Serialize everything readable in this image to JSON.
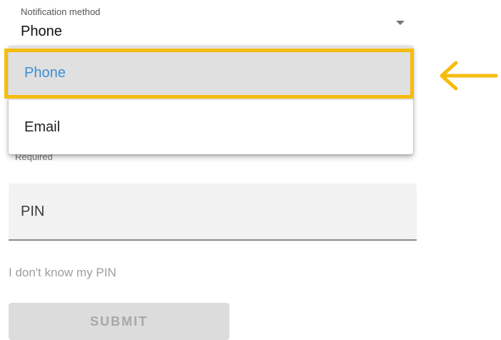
{
  "notification_select": {
    "label": "Notification method",
    "value": "Phone",
    "caret_icon": "triangle-down-icon",
    "helper_text": "Required"
  },
  "dropdown": {
    "options": [
      {
        "label": "Phone",
        "selected": true
      },
      {
        "label": "Email",
        "selected": false
      }
    ]
  },
  "annotation": {
    "highlight_color": "#f5bc0c",
    "arrow_icon": "arrow-left-icon"
  },
  "pin": {
    "placeholder": "PIN",
    "value": ""
  },
  "forgot_pin_link": "I don't know my PIN",
  "submit_button": {
    "label": "SUBMIT",
    "disabled": true
  },
  "colors": {
    "selected_option_text": "#3a8fd6",
    "selected_option_bg": "#e0e0e0",
    "field_bg": "#f2f2f2",
    "button_bg": "#dcdcdc"
  }
}
